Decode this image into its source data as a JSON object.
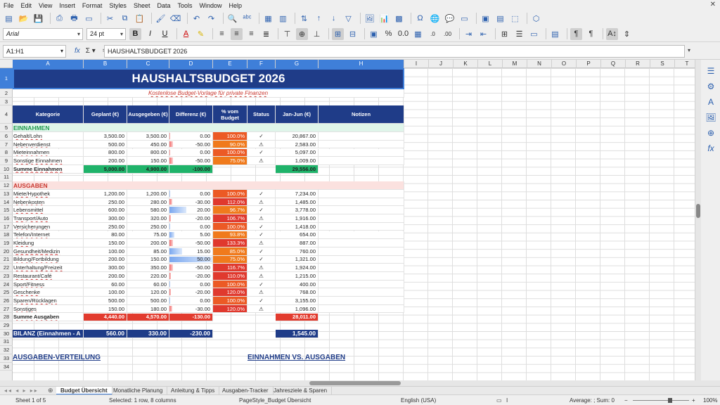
{
  "menu": [
    "File",
    "Edit",
    "View",
    "Insert",
    "Format",
    "Styles",
    "Sheet",
    "Data",
    "Tools",
    "Window",
    "Help"
  ],
  "font": {
    "name": "Arial",
    "size": "24 pt"
  },
  "namebox": "A1:H1",
  "formula": "HAUSHALTSBUDGET 2026",
  "columns": [
    "A",
    "B",
    "C",
    "D",
    "E",
    "F",
    "G",
    "H",
    "I",
    "J",
    "K",
    "L",
    "M",
    "N",
    "O",
    "P",
    "Q",
    "R",
    "S",
    "T"
  ],
  "title": "HAUSHALTSBUDGET 2026",
  "subtitle": "Kostenlose Budget-Vorlage für private Finanzen",
  "headers": {
    "kategorie": "Kategorie",
    "geplant": "Geplant (€)",
    "ausgegeben": "Ausgegeben (€)",
    "differenz": "Differenz (€)",
    "pct": "% vom Budget",
    "status": "Status",
    "janjun": "Jan-Jun (€)",
    "notizen": "Notizen"
  },
  "einnahmen_label": "EINNAHMEN",
  "einnahmen": [
    {
      "kat": "Gehalt/Lohn",
      "geplant": "3,500.00",
      "ausg": "3,500.00",
      "diff": "0.00",
      "pct": "100.0%",
      "status": "✓",
      "janjun": "20,867.00",
      "bar": 0.02
    },
    {
      "kat": "Nebenverdienst",
      "geplant": "500.00",
      "ausg": "450.00",
      "diff": "-50.00",
      "pct": "90.0%",
      "status": "⚠",
      "janjun": "2,583.00",
      "bar": 0.08
    },
    {
      "kat": "Mieteinnahmen",
      "geplant": "800.00",
      "ausg": "800.00",
      "diff": "0.00",
      "pct": "100.0%",
      "status": "✓",
      "janjun": "5,097.00",
      "bar": 0.02
    },
    {
      "kat": "Sonstige Einnahmen",
      "geplant": "200.00",
      "ausg": "150.00",
      "diff": "-50.00",
      "pct": "75.0%",
      "status": "⚠",
      "janjun": "1,009.00",
      "bar": 0.08
    }
  ],
  "summe_einnahmen": {
    "label": "Summe Einnahmen",
    "geplant": "5,000.00",
    "ausg": "4,900.00",
    "diff": "-100.00",
    "janjun": "29,556.00"
  },
  "ausgaben_label": "AUSGABEN",
  "ausgaben": [
    {
      "kat": "Miete/Hypothek",
      "geplant": "1,200.00",
      "ausg": "1,200.00",
      "diff": "0.00",
      "pct": "100.0%",
      "status": "✓",
      "janjun": "7,234.00",
      "bar": 0.02,
      "col": "blue"
    },
    {
      "kat": "Nebenkosten",
      "geplant": "250.00",
      "ausg": "280.00",
      "diff": "-30.00",
      "pct": "112.0%",
      "status": "⚠",
      "janjun": "1,485.00",
      "bar": 0.06,
      "col": "red"
    },
    {
      "kat": "Lebensmittel",
      "geplant": "600.00",
      "ausg": "580.00",
      "diff": "20.00",
      "pct": "96.7%",
      "status": "✓",
      "janjun": "3,778.00",
      "bar": 0.4,
      "col": "blue"
    },
    {
      "kat": "Transport/Auto",
      "geplant": "300.00",
      "ausg": "320.00",
      "diff": "-20.00",
      "pct": "106.7%",
      "status": "⚠",
      "janjun": "1,916.00",
      "bar": 0.04,
      "col": "red"
    },
    {
      "kat": "Versicherungen",
      "geplant": "250.00",
      "ausg": "250.00",
      "diff": "0.00",
      "pct": "100.0%",
      "status": "✓",
      "janjun": "1,418.00",
      "bar": 0.02,
      "col": "blue"
    },
    {
      "kat": "Telefon/Internet",
      "geplant": "80.00",
      "ausg": "75.00",
      "diff": "5.00",
      "pct": "93.8%",
      "status": "✓",
      "janjun": "654.00",
      "bar": 0.12,
      "col": "blue"
    },
    {
      "kat": "Kleidung",
      "geplant": "150.00",
      "ausg": "200.00",
      "diff": "-50.00",
      "pct": "133.3%",
      "status": "⚠",
      "janjun": "887.00",
      "bar": 0.08,
      "col": "red"
    },
    {
      "kat": "Gesundheit/Medizin",
      "geplant": "100.00",
      "ausg": "85.00",
      "diff": "15.00",
      "pct": "85.0%",
      "status": "✓",
      "janjun": "760.00",
      "bar": 0.3,
      "col": "blue"
    },
    {
      "kat": "Bildung/Fortbildung",
      "geplant": "200.00",
      "ausg": "150.00",
      "diff": "50.00",
      "pct": "75.0%",
      "status": "✓",
      "janjun": "1,321.00",
      "bar": 1.0,
      "col": "blue"
    },
    {
      "kat": "Unterhaltung/Freizeit",
      "geplant": "300.00",
      "ausg": "350.00",
      "diff": "-50.00",
      "pct": "116.7%",
      "status": "⚠",
      "janjun": "1,924.00",
      "bar": 0.08,
      "col": "red"
    },
    {
      "kat": "Restaurant/Café",
      "geplant": "200.00",
      "ausg": "220.00",
      "diff": "-20.00",
      "pct": "110.0%",
      "status": "⚠",
      "janjun": "1,215.00",
      "bar": 0.04,
      "col": "red"
    },
    {
      "kat": "Sport/Fitness",
      "geplant": "60.00",
      "ausg": "60.00",
      "diff": "0.00",
      "pct": "100.0%",
      "status": "✓",
      "janjun": "400.00",
      "bar": 0.02,
      "col": "blue"
    },
    {
      "kat": "Geschenke",
      "geplant": "100.00",
      "ausg": "120.00",
      "diff": "-20.00",
      "pct": "120.0%",
      "status": "⚠",
      "janjun": "768.00",
      "bar": 0.04,
      "col": "red"
    },
    {
      "kat": "Sparen/Rücklagen",
      "geplant": "500.00",
      "ausg": "500.00",
      "diff": "0.00",
      "pct": "100.0%",
      "status": "✓",
      "janjun": "3,155.00",
      "bar": 0.02,
      "col": "blue"
    },
    {
      "kat": "Sonstiges",
      "geplant": "150.00",
      "ausg": "180.00",
      "diff": "-30.00",
      "pct": "120.0%",
      "status": "⚠",
      "janjun": "1,096.00",
      "bar": 0.06,
      "col": "red"
    }
  ],
  "summe_ausgaben": {
    "label": "Summe Ausgaben",
    "geplant": "4,440.00",
    "ausg": "4,570.00",
    "diff": "-130.00",
    "janjun": "28,011.00"
  },
  "bilanz": {
    "label": "BILANZ (Einnahmen - A",
    "geplant": "560.00",
    "ausg": "330.00",
    "diff": "-230.00",
    "janjun": "1,545.00"
  },
  "section_verteilung": "AUSGABEN-VERTEILUNG",
  "section_vs": "EINNAHMEN VS. AUSGABEN",
  "tabs": [
    "Budget Übersicht",
    "Monatliche Planung",
    "Anleitung & Tipps",
    "Ausgaben-Tracker",
    "Jahresziele & Sparen"
  ],
  "status": {
    "sheet": "Sheet 1 of 5",
    "selected": "Selected: 1 row, 8 columns",
    "pagestyle": "PageStyle_Budget Übersicht",
    "lang": "English (USA)",
    "agg": "Average: ; Sum: 0",
    "zoom": "100%"
  },
  "colors": {
    "title_bg": "#1f3c88",
    "income_sum": "#1fb36a",
    "expense_sum": "#e23b2e",
    "pct_over": "#e0392e",
    "pct_near": "#f07a1c"
  }
}
